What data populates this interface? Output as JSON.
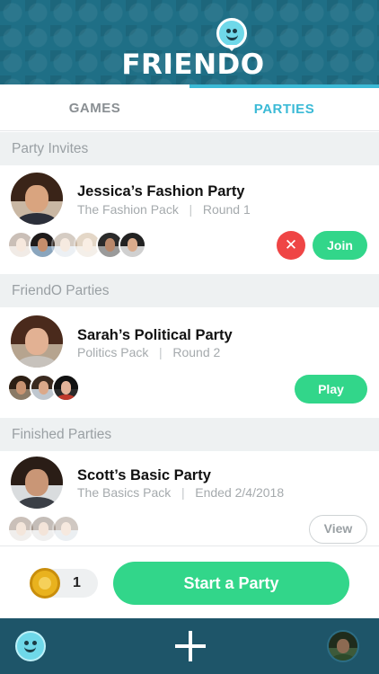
{
  "app": {
    "logo_text": "FRIENDO"
  },
  "tabs": [
    {
      "label": "GAMES",
      "active": false
    },
    {
      "label": "PARTIES",
      "active": true
    }
  ],
  "sections": {
    "invites": "Party Invites",
    "friendo": "FriendO Parties",
    "finished": "Finished Parties"
  },
  "parties": {
    "invite": {
      "name": "Jessica’s Fashion Party",
      "pack": "The Fashion Pack",
      "separator": "|",
      "status": "Round 1",
      "join_label": "Join",
      "decline_label": "✕"
    },
    "active": {
      "name": "Sarah’s Political Party",
      "pack": "Politics Pack",
      "separator": "|",
      "status": "Round 2",
      "play_label": "Play"
    },
    "finished": {
      "name": "Scott’s Basic Party",
      "pack": "The Basics Pack",
      "separator": "|",
      "status": "Ended 2/4/2018",
      "view_label": "View"
    }
  },
  "footer": {
    "coins": "1",
    "start_label": "Start a Party"
  },
  "colors": {
    "accent": "#3bbad6",
    "green": "#32d68a",
    "decline": "#ef4545",
    "header": "#1f6f86",
    "navbar": "#1e5569"
  },
  "icons": [
    "friendo-logo-icon",
    "coin-icon",
    "plus-icon",
    "smiley-icon",
    "close-icon"
  ]
}
